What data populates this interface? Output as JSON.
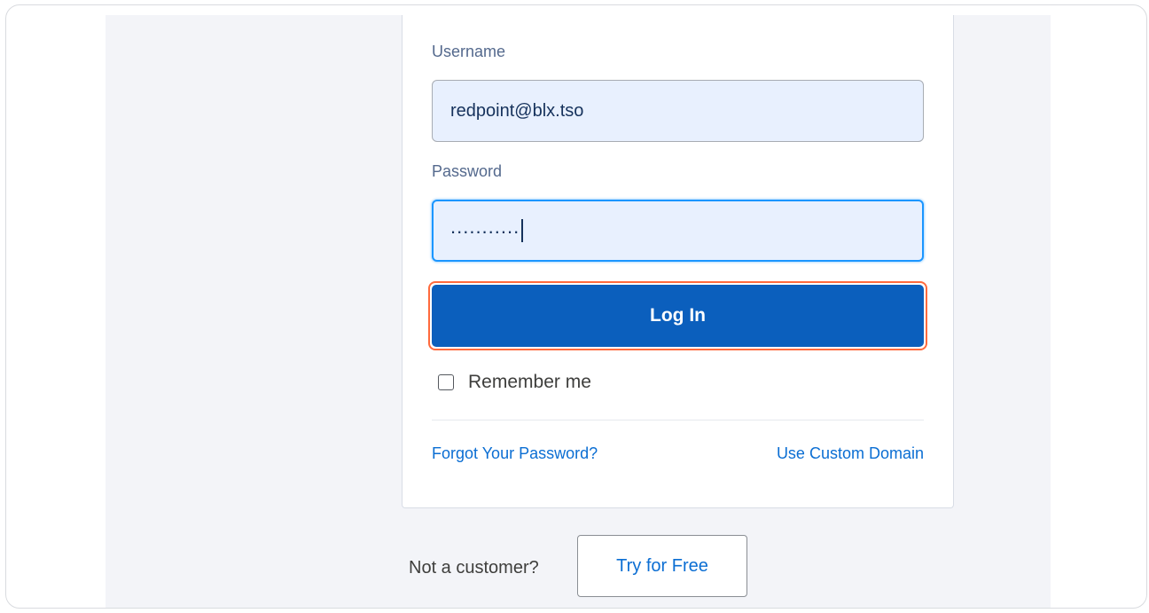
{
  "form": {
    "username_label": "Username",
    "username_value": "redpoint@blx.tso",
    "password_label": "Password",
    "password_masked": "...........",
    "login_label": "Log In",
    "remember_label": "Remember me",
    "remember_checked": false
  },
  "links": {
    "forgot_password": "Forgot Your Password?",
    "custom_domain": "Use Custom Domain"
  },
  "footer": {
    "not_customer": "Not a customer?",
    "try_free": "Try for Free"
  },
  "colors": {
    "accent": "#0b5fbd",
    "highlight": "#ff6a3d",
    "link": "#0b6ed3",
    "page_background": "#f3f4f8"
  }
}
